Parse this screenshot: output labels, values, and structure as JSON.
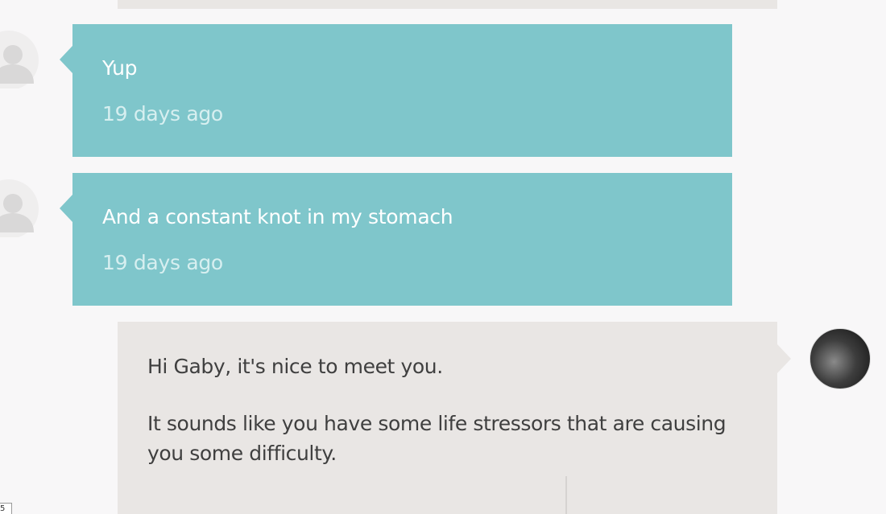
{
  "messages": [
    {
      "sender": "user",
      "text": "Yup",
      "time": "19 days ago"
    },
    {
      "sender": "user",
      "text": "And a constant knot in my stomach",
      "time": "19 days ago"
    },
    {
      "sender": "counselor",
      "paragraphs": [
        "Hi Gaby, it's nice to meet you.",
        "It sounds like you have some life stressors that are causing you some difficulty."
      ]
    }
  ],
  "icons": {
    "user_avatar": "user-silhouette-icon",
    "counselor_avatar": "profile-photo"
  },
  "colors": {
    "user_bubble": "#7fc6cb",
    "counselor_bubble": "#e9e6e4",
    "background": "#f8f7f8"
  },
  "corner_tag": "5"
}
